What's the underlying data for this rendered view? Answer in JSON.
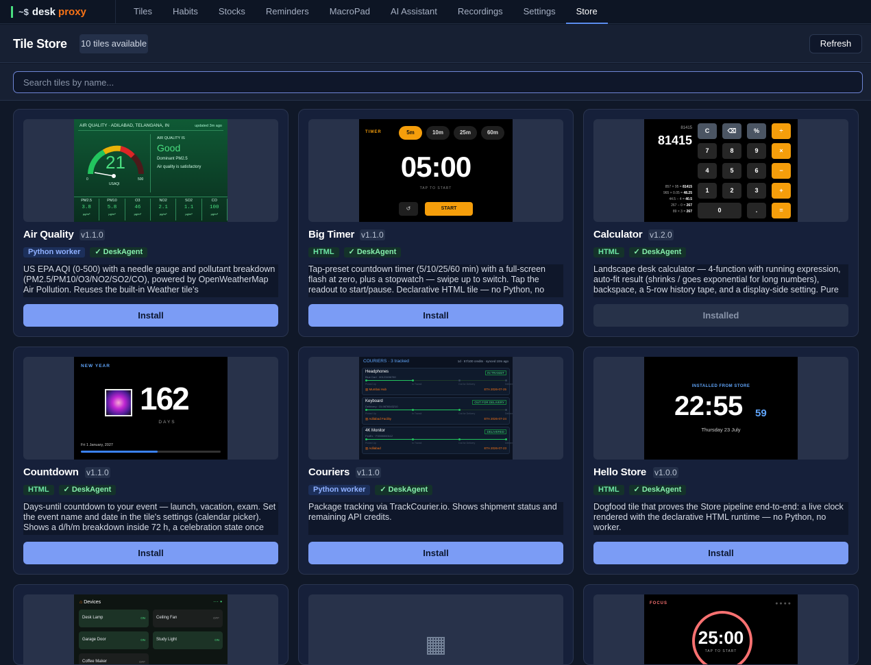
{
  "brand": {
    "word1": "desk",
    "word2": "proxy"
  },
  "nav": [
    "Tiles",
    "Habits",
    "Stocks",
    "Reminders",
    "MacroPad",
    "AI Assistant",
    "Recordings",
    "Settings",
    "Store"
  ],
  "nav_active": "Store",
  "header": {
    "title": "Tile Store",
    "count": "10 tiles available",
    "refresh": "Refresh"
  },
  "search": {
    "placeholder": "Search tiles by name..."
  },
  "cards": [
    {
      "name": "Air Quality",
      "version": "v1.1.0",
      "badge1": "Python worker",
      "badge2": "✓ DeskAgent",
      "desc": "US EPA AQI (0-500) with a needle gauge and pollutant breakdown (PM2.5/PM10/O3/NO2/SO2/CO), powered by OpenWeatherMap Air Pollution. Reuses the built-in Weather tile's",
      "action": "Install"
    },
    {
      "name": "Big Timer",
      "version": "v1.1.0",
      "badge1": "HTML",
      "badge2": "✓ DeskAgent",
      "desc": "Tap-preset countdown timer (5/10/25/60 min) with a full-screen flash at zero, plus a stopwatch — swipe up to switch. Tap the readout to start/pause. Declarative HTML tile — no Python, no",
      "action": "Install"
    },
    {
      "name": "Calculator",
      "version": "v1.2.0",
      "badge1": "HTML",
      "badge2": "✓ DeskAgent",
      "desc": "Landscape desk calculator — 4-function with running expression, auto-fit result (shrinks / goes exponential for long numbers), backspace, a 5-row history tape, and a display-side setting. Pure",
      "action": "Installed"
    },
    {
      "name": "Countdown",
      "version": "v1.1.0",
      "badge1": "HTML",
      "badge2": "✓ DeskAgent",
      "desc": "Days-until countdown to your event — launch, vacation, exam. Set the event name and date in the tile's settings (calendar picker). Shows a d/h/m breakdown inside 72 h, a celebration state once",
      "action": "Install"
    },
    {
      "name": "Couriers",
      "version": "v1.1.0",
      "badge1": "Python worker",
      "badge2": "✓ DeskAgent",
      "desc": "Package tracking via TrackCourier.io. Shows shipment status and remaining API credits.",
      "action": "Install"
    },
    {
      "name": "Hello Store",
      "version": "v1.0.0",
      "badge1": "HTML",
      "badge2": "✓ DeskAgent",
      "desc": "Dogfood tile that proves the Store pipeline end-to-end: a live clock rendered with the declarative HTML runtime — no Python, no worker.",
      "action": "Install"
    }
  ],
  "preview": {
    "aq": {
      "head": "AIR QUALITY · ADILABAD, TELANGANA, IN",
      "updated": "updated 3m ago",
      "value": "21",
      "unit": "USAQI",
      "min": "0",
      "max": "500",
      "label": "AIR QUALITY IS",
      "status": "Good",
      "dominant": "Dominant PM2.5",
      "note": "Air quality is satisfactory",
      "pollutants": [
        {
          "n": "PM2.5",
          "v": "3.8"
        },
        {
          "n": "PM10",
          "v": "5.8"
        },
        {
          "n": "O3",
          "v": "46"
        },
        {
          "n": "NO2",
          "v": "2.1"
        },
        {
          "n": "SO2",
          "v": "1.1"
        },
        {
          "n": "CO",
          "v": "100"
        }
      ],
      "pollutant_unit": "µg/m³"
    },
    "timer": {
      "label": "TIMER",
      "presets": [
        "5m",
        "10m",
        "25m",
        "60m"
      ],
      "time": "05:00",
      "hint": "TAP TO START",
      "reset": "↺",
      "start": "START"
    },
    "calc": {
      "small": "81415",
      "big": "81415",
      "keys": [
        "C",
        "⌫",
        "%",
        "÷",
        "7",
        "8",
        "9",
        "×",
        "4",
        "5",
        "6",
        "−",
        "1",
        "2",
        "3",
        "+",
        "0",
        ".",
        "="
      ],
      "tape": [
        {
          "e": "857 × 95 =",
          "r": "81415"
        },
        {
          "e": "965 × 0.05 =",
          "r": "48.25"
        },
        {
          "e": "44.5 − 4 =",
          "r": "40.5"
        },
        {
          "e": "267 − 0 =",
          "r": "267"
        },
        {
          "e": "89 × 3 =",
          "r": "267"
        }
      ]
    },
    "countdown": {
      "label": "NEW YEAR",
      "days": "162",
      "unit": "DAYS",
      "date": "Fri 1 January, 2027",
      "progress": 0.55
    },
    "couriers": {
      "title": "COURIERS",
      "tracked": "· 3 tracked",
      "credits": "1d · 57/100 credits · synced 10m ago",
      "stages": [
        "Picked Up",
        "In Transit",
        "Out for Delivery",
        "Delivered"
      ],
      "items": [
        {
          "name": "Headphones",
          "sub": "Blue Dart · 80123456780",
          "status": "IN TRANSIT",
          "loc": "Mumbai Hub",
          "eta": "ETA 2026-07-25",
          "step": 2
        },
        {
          "name": "Keyboard",
          "sub": "Delhivery · DL9876543210",
          "status": "OUT FOR DELIVERY",
          "loc": "Adilabad Facility",
          "eta": "ETA 2026-07-24",
          "step": 3
        },
        {
          "name": "4K Monitor",
          "sub": "FedEx · FX555000112",
          "status": "DELIVERED",
          "loc": "Adilabad",
          "eta": "ETA 2026-07-23",
          "step": 4
        }
      ]
    },
    "hello": {
      "label": "INSTALLED FROM STORE",
      "time": "22:55",
      "sec": "59",
      "date": "Thursday 23 July"
    },
    "devices": {
      "title": "Devices",
      "items": [
        {
          "n": "Desk Lamp",
          "s": "ON"
        },
        {
          "n": "Ceiling Fan",
          "s": "OFF"
        },
        {
          "n": "Garage Door",
          "s": "ON"
        },
        {
          "n": "Study Light",
          "s": "ON"
        },
        {
          "n": "Coffee Maker",
          "s": "OFF"
        }
      ]
    },
    "focus": {
      "label": "FOCUS",
      "time": "25:00",
      "hint": "TAP TO START"
    }
  }
}
